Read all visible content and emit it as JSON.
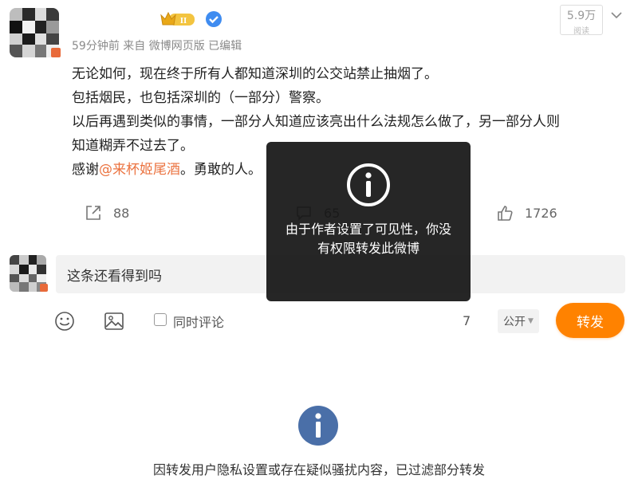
{
  "post": {
    "username": "",
    "meta": "59分钟前 来自 微博网页版 已编辑",
    "reads_count": "5.9万",
    "reads_label": "阅读",
    "content": {
      "line1": "无论如何，现在终于所有人都知道深圳的公交站禁止抽烟了。",
      "line2": "包括烟民，也包括深圳的（一部分）警察。",
      "line3": "以后再遇到类似的事情，一部分人知道应该亮出什么法规怎么做了，另一部分人则",
      "line4": "知道糊弄不过去了。",
      "line5_prefix": "感谢",
      "mention": "@来杯姬尾酒",
      "line5_suffix": "。勇敢的人。"
    },
    "actions": {
      "forward_count": "88",
      "comment_count": "65",
      "like_count": "1726"
    }
  },
  "reply": {
    "text": "这条还看得到吗",
    "also_comment_label": "同时评论",
    "char_count": "7",
    "visibility": "公开",
    "forward_button": "转发"
  },
  "toast": {
    "message": "由于作者设置了可见性，你没有权限转发此微博"
  },
  "filter_notice": "因转发用户隐私设置或存在疑似骚扰内容，已过滤部分转发",
  "colors": {
    "accent": "#ff8200",
    "mention": "#eb7340",
    "info_icon": "#4a6fa8"
  }
}
